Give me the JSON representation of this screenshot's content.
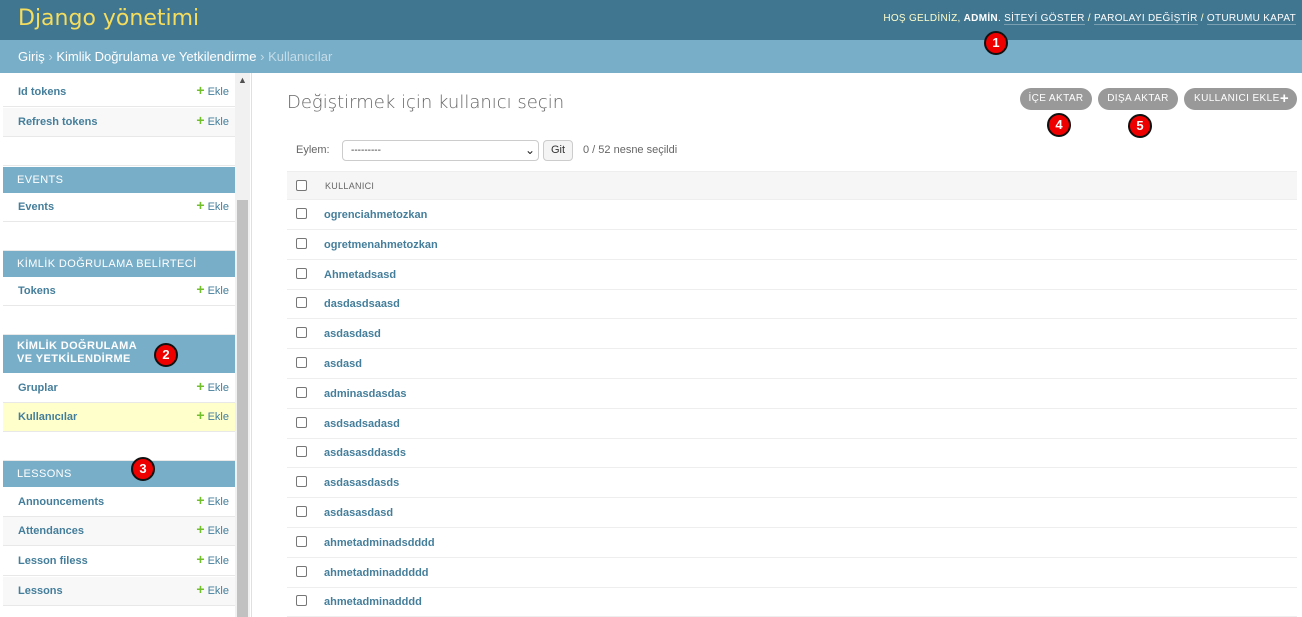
{
  "header": {
    "branding": "Django yönetimi",
    "welcome": "HOŞ GELDİNİZ,",
    "username": "ADMİN",
    "view_site": "SİTEYİ GÖSTER",
    "change_password": "PAROLAYI DEĞİŞTİR",
    "logout": "OTURUMU KAPAT",
    "separator": "/",
    "brand_color": "#417690",
    "branding_color": "#f5dd5d"
  },
  "breadcrumbs": {
    "home": "Giriş",
    "app": "Kimlik Doğrulama ve Yetkilendirme",
    "current": "Kullanıcılar",
    "separator": "›"
  },
  "annotations": [
    "1",
    "2",
    "3",
    "4",
    "5"
  ],
  "sidebar": {
    "add_label": "Ekle",
    "groups": [
      {
        "caption": "",
        "models": [
          "Id tokens",
          "Refresh tokens"
        ]
      },
      {
        "caption": "EVENTS",
        "models": [
          "Events"
        ]
      },
      {
        "caption": "KİMLİK DOĞRULAMA BELİRTECİ",
        "models": [
          "Tokens"
        ]
      },
      {
        "caption": "KİMLİK DOĞRULAMA VE YETKİLENDİRME",
        "models": [
          "Gruplar",
          "Kullanıcılar"
        ]
      },
      {
        "caption": "LESSONS",
        "models": [
          "Announcements",
          "Attendances",
          "Lesson filess",
          "Lessons"
        ]
      }
    ],
    "caption_color": "#79aec8",
    "selected_color": "#ffffcc"
  },
  "main": {
    "title": "Değiştirmek için kullanıcı seçin",
    "tools": {
      "import": "İÇE AKTAR",
      "export": "DIŞA AKTAR",
      "add_user": "KULLANICI EKLE"
    },
    "actions": {
      "label": "Eylem:",
      "selected_option": "---------",
      "go": "Git",
      "counter": "0 / 52 nesne seçildi"
    },
    "table": {
      "column_header": "KULLANICI",
      "rows": [
        "ogrenciahmetozkan",
        "ogretmenahmetozkan",
        "Ahmetadsasd",
        "dasdasdsaasd",
        "asdasdasd",
        "asdasd",
        "adminasdasdas",
        "asdsadsadasd",
        "asdasasddasds",
        "asdasasdasds",
        "asdasasdasd",
        "ahmetadminadsdddd",
        "ahmetadminaddddd",
        "ahmetadminadddd"
      ]
    }
  }
}
